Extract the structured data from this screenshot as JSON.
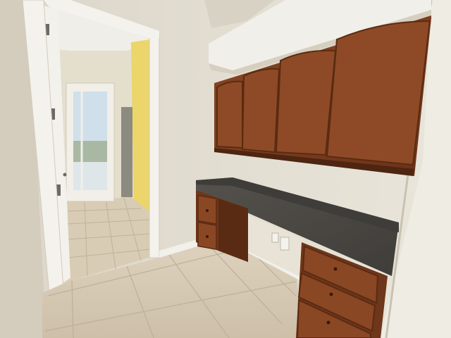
{
  "photo": {
    "subject": "interior-built-in-desk-nook",
    "colors": {
      "wall": "#e3ded2",
      "wall_shadow": "#cfc8b8",
      "ceiling": "#ece9e2",
      "hall_wall_yellow": "#ecd56a",
      "hall_wall_light": "#e6e2cf",
      "tile": "#d6c9b4",
      "tile_grout": "#bfb29c",
      "cabinet_wood": "#7a3d1f",
      "cabinet_wood_dark": "#5c2c14",
      "countertop": "#4d4b47",
      "trim_white": "#f2f0ea",
      "glass_daylight": "#cfe0ea"
    }
  }
}
